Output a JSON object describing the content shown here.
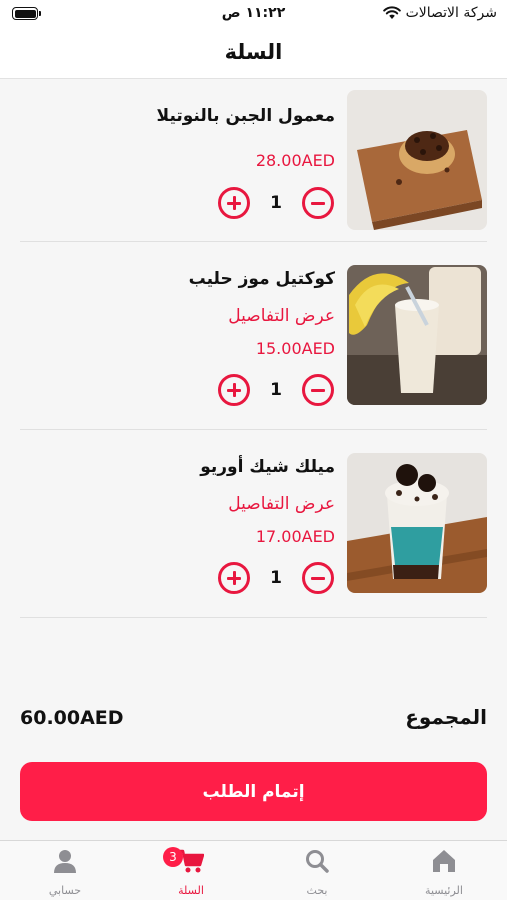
{
  "status_bar": {
    "time": "١١:٢٢ ص",
    "carrier": "شركة الاتصالات"
  },
  "header": {
    "title": "السلة"
  },
  "cart": {
    "items": [
      {
        "name": "معمول الجبن بالنوتيلا",
        "details_label": "",
        "price": "28.00AED",
        "quantity": "1",
        "image_icon": "nutella-cheese-maamoul-photo"
      },
      {
        "name": "كوكتيل موز حليب",
        "details_label": "عرض التفاصيل",
        "price": "15.00AED",
        "quantity": "1",
        "image_icon": "banana-milk-cocktail-photo"
      },
      {
        "name": "ميلك شيك أوريو",
        "details_label": "عرض التفاصيل",
        "price": "17.00AED",
        "quantity": "1",
        "image_icon": "oreo-milkshake-photo"
      }
    ]
  },
  "summary": {
    "total_label": "المجموع",
    "total_value": "60.00AED"
  },
  "checkout": {
    "label": "إتمام الطلب"
  },
  "tab_bar": {
    "tabs": [
      {
        "label": "الرئيسية",
        "icon": "home-icon"
      },
      {
        "label": "بحث",
        "icon": "search-icon"
      },
      {
        "label": "السلة",
        "icon": "cart-icon",
        "badge": "3",
        "active": true
      },
      {
        "label": "حسابي",
        "icon": "user-icon"
      }
    ]
  },
  "colors": {
    "accent": "#e8173f",
    "button": "#ff1e48",
    "inactive": "#8e8e93"
  }
}
